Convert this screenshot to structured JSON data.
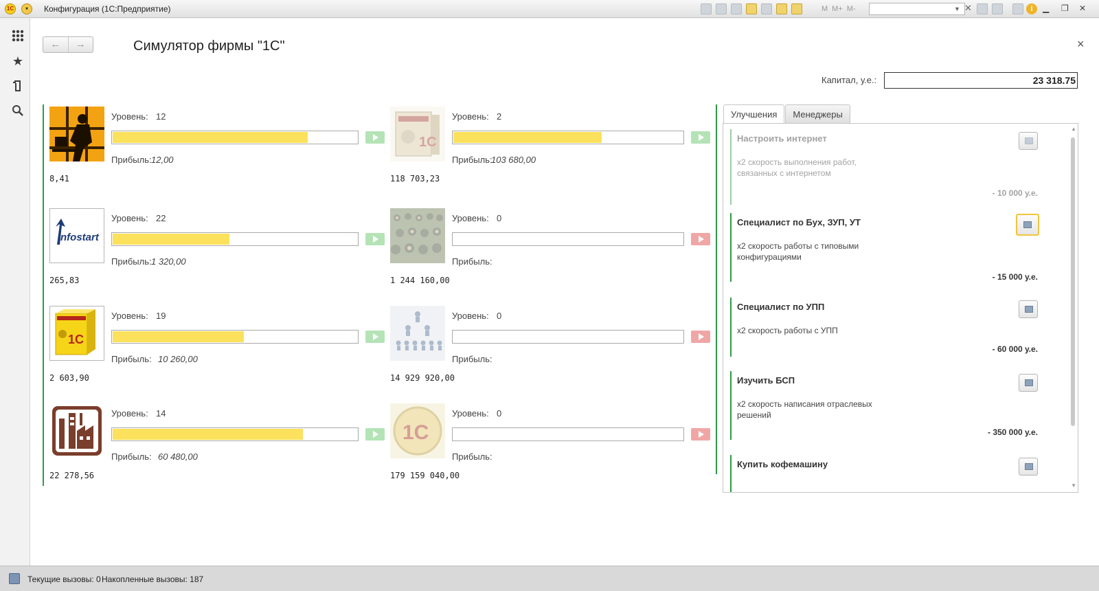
{
  "window": {
    "title": "Конфигурация  (1С:Предприятие)"
  },
  "toolbar": {
    "memory_buttons": [
      "M",
      "M+",
      "M-"
    ],
    "search_value": ""
  },
  "page": {
    "title": "Симулятор фирмы \"1С\"",
    "capital_label": "Капитал, у.е.:",
    "capital_value": "23 318.75"
  },
  "businesses": [
    {
      "image": "silhouette-at-computer",
      "level_label": "Уровень:",
      "level": "12",
      "progress": 0.8,
      "action": "enabled",
      "profit_label": "Прибыль:",
      "profit": "12,00",
      "income": "8,41"
    },
    {
      "image": "1c-pomoshchnik-box",
      "level_label": "Уровень:",
      "level": "2",
      "progress": 0.65,
      "action": "enabled",
      "profit_label": "Прибыль:",
      "profit": "103 680,00",
      "income": "118 703,23"
    },
    {
      "image": "infostart-logo",
      "level_label": "Уровень:",
      "level": "22",
      "progress": 0.48,
      "action": "enabled",
      "profit_label": "Прибыль:",
      "profit": "1 320,00",
      "income": "265,83"
    },
    {
      "image": "crowd-photo",
      "level_label": "Уровень:",
      "level": "0",
      "progress": 0,
      "action": "disabled",
      "profit_label": "Прибыль:",
      "profit": "",
      "income": "1 244 160,00"
    },
    {
      "image": "1c-buhgalteria-box",
      "level_label": "Уровень:",
      "level": "19",
      "progress": 0.54,
      "action": "enabled",
      "profit_label": "Прибыль:",
      "profit": "10 260,00",
      "income": "2 603,90"
    },
    {
      "image": "org-structure",
      "level_label": "Уровень:",
      "level": "0",
      "progress": 0,
      "action": "disabled",
      "profit_label": "Прибыль:",
      "profit": "",
      "income": "14 929 920,00"
    },
    {
      "image": "factory-icon",
      "level_label": "Уровень:",
      "level": "14",
      "progress": 0.78,
      "action": "enabled",
      "profit_label": "Прибыль:",
      "profit": "60 480,00",
      "income": "22 278,56"
    },
    {
      "image": "1c-logo-coin",
      "level_label": "Уровень:",
      "level": "0",
      "progress": 0,
      "action": "disabled",
      "profit_label": "Прибыль:",
      "profit": "",
      "income": "179 159 040,00"
    }
  ],
  "tabs": [
    "Улучшения",
    "Менеджеры"
  ],
  "upgrades": [
    {
      "title": "Настроить интернет",
      "desc": "x2 скорость выполнения работ, связанных с интернетом",
      "cost": "- 10 000 у.е.",
      "state": "disabled"
    },
    {
      "title": "Специалист по Бух, ЗУП, УТ",
      "desc": "x2 скорость работы с типовыми конфигурациями",
      "cost": "- 15 000 у.е.",
      "state": "selected"
    },
    {
      "title": "Специалист по УПП",
      "desc": "x2 скорость работы с УПП",
      "cost": "- 60 000 у.е.",
      "state": "enabled"
    },
    {
      "title": "Изучить БСП",
      "desc": "x2 скорость написания отраслевых решений",
      "cost": "- 350 000 у.е.",
      "state": "enabled"
    },
    {
      "title": "Купить кофемашину",
      "desc": "",
      "cost": "",
      "state": "enabled"
    }
  ],
  "status": {
    "current_calls": "Текущие вызовы: 0",
    "accumulated_calls": "Накопленные вызовы: 187"
  },
  "colors": {
    "accent_green": "#2e9a47",
    "progress_yellow": "#fbe15c",
    "play_green": "#b4e3b6",
    "play_red": "#f1a6a6"
  }
}
